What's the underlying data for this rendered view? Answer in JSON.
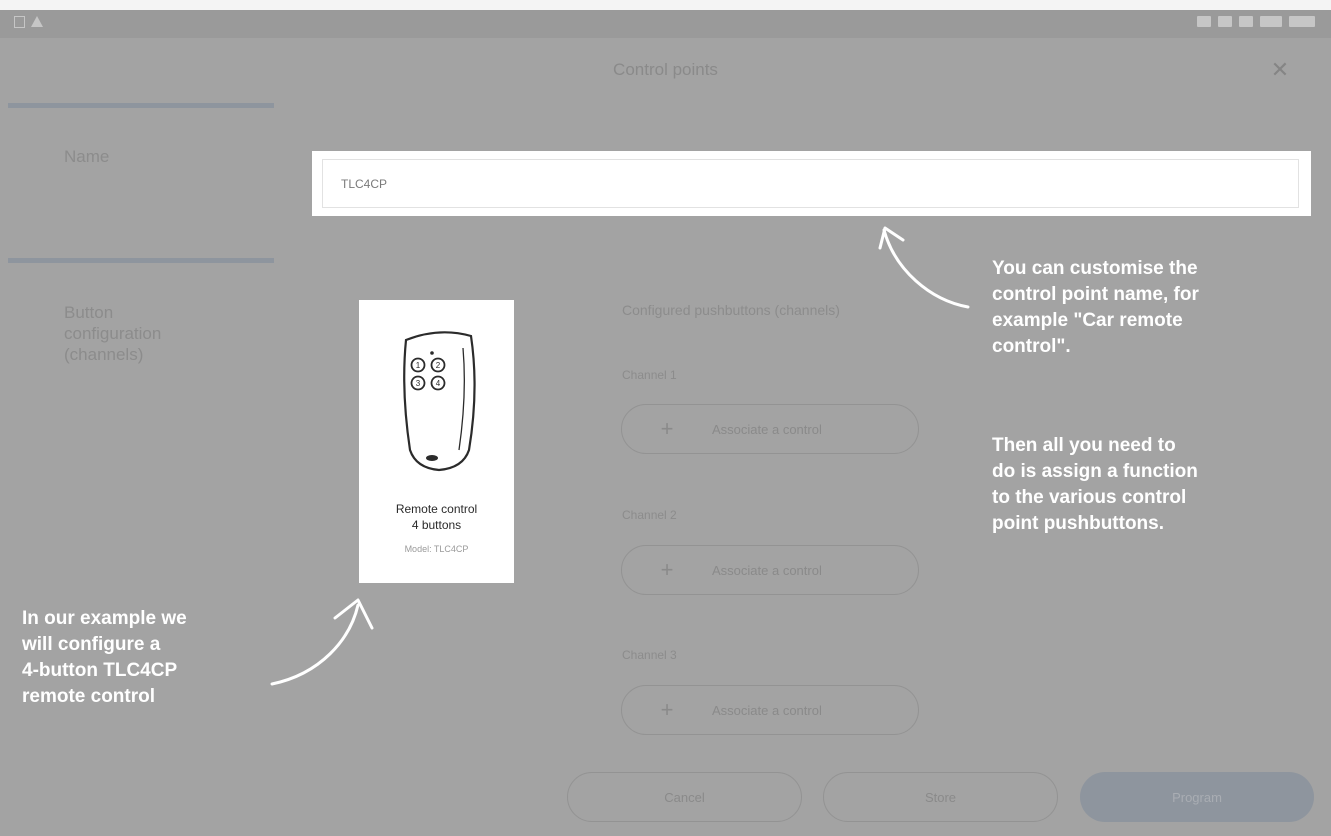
{
  "dialog": {
    "title": "Control points",
    "close_icon": "close-icon"
  },
  "sidebar": {
    "name_label": "Name",
    "button_config_label": [
      "Button",
      "configuration",
      "(channels)"
    ]
  },
  "name_field": {
    "value": "TLC4CP"
  },
  "remote_card": {
    "icon": "remote-control-icon",
    "title_line1": "Remote control",
    "title_line2": "4 buttons",
    "model": "Model: TLC4CP",
    "button_numbers": [
      "1",
      "2",
      "3",
      "4"
    ]
  },
  "channels": {
    "heading": "Configured pushbuttons (channels)",
    "items": [
      {
        "label": "Channel 1",
        "action": "Associate a control"
      },
      {
        "label": "Channel 2",
        "action": "Associate a control"
      },
      {
        "label": "Channel 3",
        "action": "Associate a control"
      }
    ]
  },
  "footer": {
    "cancel": "Cancel",
    "store": "Store",
    "program": "Program"
  },
  "annotations": {
    "name_note": [
      "You can customise the",
      "control point name, for",
      "example \"Car remote",
      "control\"."
    ],
    "assign_note": [
      "Then all you need to",
      "do is assign a function",
      "to the various control",
      "point pushbuttons."
    ],
    "example_note": [
      "In our example we",
      "will configure a",
      "4-button TLC4CP",
      "remote control"
    ]
  },
  "colors": {
    "overlay": "#a3a3a3",
    "accent_gray": "#8e959e",
    "note_text": "#ffffff"
  }
}
